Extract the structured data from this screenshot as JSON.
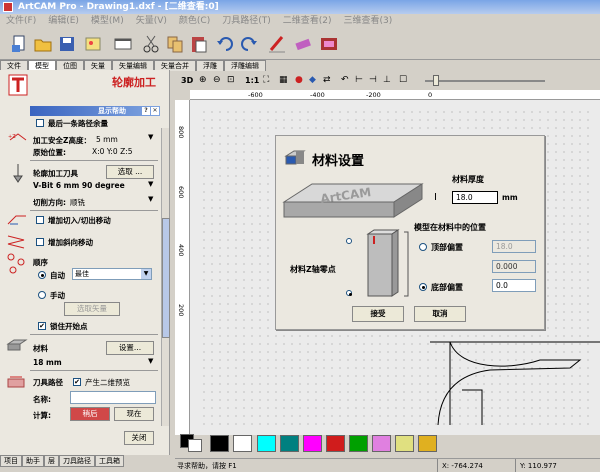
{
  "window": {
    "title": "ArtCAM Pro - Drawing1.dxf - [二维查看:0]"
  },
  "menu": [
    "文件(F)",
    "编辑(E)",
    "模型(M)",
    "矢量(V)",
    "颜色(C)",
    "刀具路径(T)",
    "二维查看(2)",
    "三维查看(3)"
  ],
  "tabs": [
    "文件",
    "模型",
    "位图",
    "矢量",
    "矢量编辑",
    "矢量合并",
    "浮雕",
    "浮雕编辑"
  ],
  "panel": {
    "title": "轮廓加工",
    "help_bar": "显示帮助",
    "last_pass_label": "最后一条路径余量",
    "safe_z_label": "加工安全Z高度：",
    "safe_z_value": "5 mm",
    "origin_label": "原始位置:",
    "origin_value": "X:0 Y:0 Z:5",
    "tool_label": "轮廓加工刀具",
    "select_button": "选取 ...",
    "tool_value": "V-Bit 6 mm 90 degree",
    "cut_dir_label": "切削方向:",
    "cut_dir_value": "顺铣",
    "lead_in_label": "增加切入/切出移动",
    "ramp_label": "增加斜向移动",
    "order_label": "顺序",
    "auto_label": "自动",
    "auto_value": "最佳",
    "manual_label": "手动",
    "select_vector_button": "选取矢量",
    "lock_start_label": "锁住开始点",
    "material_label": "材料",
    "setup_button": "设置...",
    "material_value": "18 mm",
    "toolpath_label": "刀具路径",
    "preview_label": "产生二维预览",
    "name_label": "名称:",
    "name_value": "",
    "calc_label": "计算:",
    "later_button": "稍后",
    "now_button": "现在",
    "close_button": "关闭"
  },
  "bottom_tabs": [
    "项目",
    "助手",
    "层",
    "刀具路径",
    "工具箱"
  ],
  "view_toolbar": {
    "mode": "3D",
    "zoom": "1:1"
  },
  "ruler": {
    "h": [
      "-600",
      "-400",
      "-200",
      "0"
    ],
    "v": [
      "800",
      "600",
      "400",
      "200"
    ]
  },
  "dialog": {
    "title": "材料设置",
    "thickness_label": "材料厚度",
    "thickness_value": "18.0",
    "thickness_unit": "mm",
    "model_pos_label": "模型在材料中的位置",
    "top_offset_label": "顶部偏置",
    "top_offset_value": "18.0",
    "mid_value": "0.000",
    "bottom_offset_label": "底部偏置",
    "bottom_offset_value": "0.0",
    "zero_label": "材料Z轴零点",
    "block_text": "ArtCAM",
    "accept_button": "接受",
    "cancel_button": "取消"
  },
  "colors": [
    "#000000",
    "#ffffff",
    "#ffffff",
    "#00ffff",
    "#008080",
    "#ff00ff",
    "#d01c1c",
    "#00a000",
    "#e080e0",
    "#e0e080",
    "#e0b020"
  ],
  "status": {
    "help": "寻求帮助，请按 F1",
    "x": "X: -764.274",
    "y": "Y: 110.977"
  }
}
